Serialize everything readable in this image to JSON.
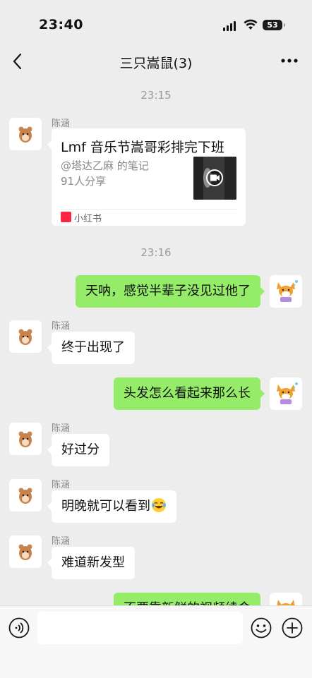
{
  "status_bar": {
    "time": "23:40",
    "battery": "53"
  },
  "header": {
    "title": "三只嵩鼠(3)"
  },
  "messages": [
    {
      "type": "timestamp",
      "text": "23:15"
    },
    {
      "type": "card",
      "sender": "陈涵",
      "title": "Lmf 音乐节嵩哥彩排完下班",
      "author": "@塔达乙麻 的笔记",
      "shares": "91人分享",
      "source": "小红书"
    },
    {
      "type": "timestamp",
      "text": "23:16"
    },
    {
      "type": "text",
      "direction": "out",
      "text": "天呐，感觉半辈子没见过他了"
    },
    {
      "type": "text",
      "direction": "in",
      "sender": "陈涵",
      "text": "终于出现了"
    },
    {
      "type": "text",
      "direction": "out",
      "text": "头发怎么看起来那么长"
    },
    {
      "type": "text",
      "direction": "in",
      "sender": "陈涵",
      "text": "好过分"
    },
    {
      "type": "text",
      "direction": "in",
      "sender": "陈涵",
      "text": "明晚就可以看到",
      "emoji": "tears-of-joy"
    },
    {
      "type": "text",
      "direction": "in",
      "sender": "陈涵",
      "text": "难道新发型"
    },
    {
      "type": "text",
      "direction": "out",
      "text": "不要靠新鲜的视频续命"
    }
  ],
  "input": {
    "value": "",
    "placeholder": ""
  },
  "icons": {
    "back": "chevron-left-icon",
    "more": "more-dots-icon",
    "voice": "voice-icon",
    "emoji": "smile-icon",
    "plus": "plus-icon"
  },
  "colors": {
    "outgoing_bubble": "#95ec69",
    "incoming_bubble": "#ffffff",
    "background": "#ededed"
  }
}
